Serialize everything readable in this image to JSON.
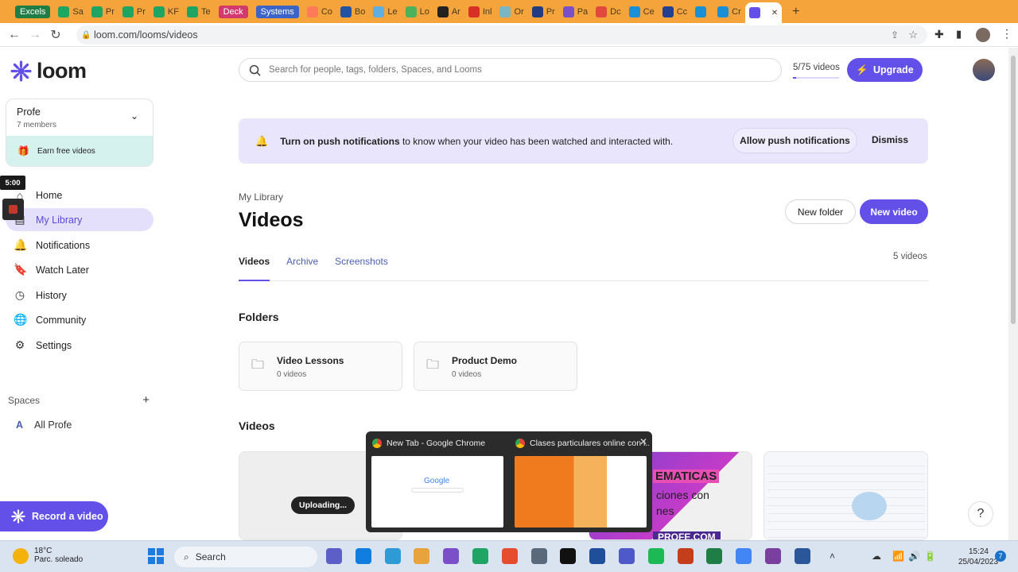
{
  "browser": {
    "tabs": [
      {
        "label": "Excels",
        "color": "#1e7e45",
        "labeled": true
      },
      {
        "label": "Sa",
        "color": "#1fa463"
      },
      {
        "label": "Pr",
        "color": "#1fa463"
      },
      {
        "label": "Pr",
        "color": "#1fa463"
      },
      {
        "label": "KF",
        "color": "#1fa463"
      },
      {
        "label": "Te",
        "color": "#1fa463"
      },
      {
        "label": "Deck",
        "color": "#d23a6e",
        "labeled": true
      },
      {
        "label": "Systems",
        "color": "#3b63c8",
        "labeled": true
      },
      {
        "label": "Co",
        "color": "#ff7a59"
      },
      {
        "label": "Bo",
        "color": "#2553a3"
      },
      {
        "label": "Le",
        "color": "#5fb0e0"
      },
      {
        "label": "Lo",
        "color": "#4db05a"
      },
      {
        "label": "Ar",
        "color": "#222222"
      },
      {
        "label": "Inl",
        "color": "#d93025"
      },
      {
        "label": "Or",
        "color": "#7ab6c4"
      },
      {
        "label": "Pr",
        "color": "#253b80"
      },
      {
        "label": "Pa",
        "color": "#7a4fc7"
      },
      {
        "label": "Dc",
        "color": "#e2483d"
      },
      {
        "label": "Ce",
        "color": "#1a8fd6"
      },
      {
        "label": "Cc",
        "color": "#243f8f"
      },
      {
        "label": "",
        "color": "#1a8fd6"
      },
      {
        "label": "Cr",
        "color": "#1a8fd6"
      },
      {
        "label": "",
        "color": "#6250e8",
        "active": true
      }
    ],
    "url": "loom.com/looms/videos"
  },
  "sidebar": {
    "logo_text": "loom",
    "workspace": {
      "name": "Profe",
      "members": "7 members",
      "earn": "Earn free videos"
    },
    "items": [
      {
        "label": "Home",
        "icon": "home-icon",
        "glyph": "⌂"
      },
      {
        "label": "My Library",
        "icon": "library-icon",
        "glyph": "▤",
        "active": true
      },
      {
        "label": "Notifications",
        "icon": "bell-icon",
        "glyph": "🔔"
      },
      {
        "label": "Watch Later",
        "icon": "bookmark-icon",
        "glyph": "🔖"
      },
      {
        "label": "History",
        "icon": "clock-icon",
        "glyph": "◷"
      },
      {
        "label": "Community",
        "icon": "globe-icon",
        "glyph": "🌐"
      },
      {
        "label": "Settings",
        "icon": "gear-icon",
        "glyph": "⚙"
      }
    ],
    "spaces_label": "Spaces",
    "space_letter": "A",
    "space_name": "All Profe",
    "record_label": "Record a video",
    "timer": "5:00"
  },
  "header": {
    "search_placeholder": "Search for people, tags, folders, Spaces, and Looms",
    "video_usage": "5/75 videos",
    "usage_fraction": 0.067,
    "upgrade_label": "Upgrade"
  },
  "banner": {
    "bold": "Turn on push notifications",
    "text": " to know when your video has been watched and interacted with.",
    "allow_label": "Allow push notifications",
    "dismiss_label": "Dismiss"
  },
  "library": {
    "breadcrumb": "My Library",
    "title": "Videos",
    "new_folder": "New folder",
    "new_video": "New video",
    "tabs": [
      "Videos",
      "Archive",
      "Screenshots"
    ],
    "count": "5 videos",
    "folders_title": "Folders",
    "folders": [
      {
        "name": "Video Lessons",
        "count": "0 videos"
      },
      {
        "name": "Product Demo",
        "count": "0 videos"
      }
    ],
    "videos_title": "Videos",
    "uploading": "Uploading...",
    "thumb_text_1": "EMATICAS",
    "thumb_text_2": "ciones con",
    "thumb_text_3": "nes",
    "thumb_text_4": "PROFE.COM"
  },
  "preview": {
    "items": [
      {
        "title": "New Tab - Google Chrome"
      },
      {
        "title": "Clases particulares online con l..."
      }
    ],
    "google_text": "Google"
  },
  "taskbar": {
    "temp": "18°C",
    "weather": "Parc. soleado",
    "search": "Search",
    "time": "15:24",
    "date": "25/04/2023",
    "notif_count": "7"
  },
  "help": "?"
}
